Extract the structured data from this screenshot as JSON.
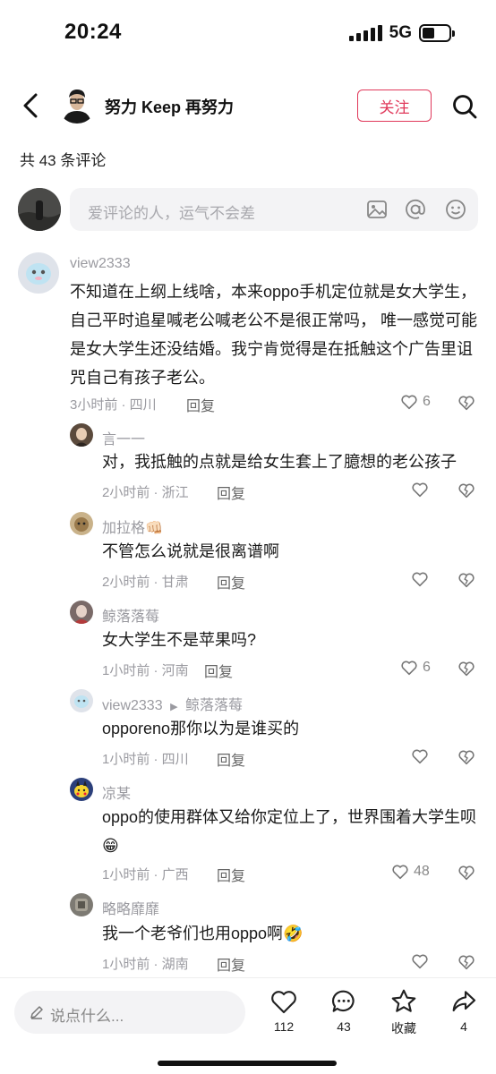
{
  "status": {
    "time": "20:24",
    "network": "5G"
  },
  "header": {
    "title": "努力 Keep 再努力",
    "follow_label": "关注"
  },
  "comment_count": "共 43 条评论",
  "input": {
    "placeholder": "爱评论的人，运气不会差"
  },
  "comments": [
    {
      "name": "view2333",
      "text": "不知道在上纲上线啥，本来oppo手机定位就是女大学生，自己平时追星喊老公喊老公不是很正常吗，  唯一感觉可能是女大学生还没结婚。我宁肯觉得是在抵触这个广告里诅咒自己有孩子老公。",
      "meta": "3小时前 · 四川",
      "reply": "回复",
      "likes": "6"
    },
    {
      "name": "言一一",
      "text": "对，我抵触的点就是给女生套上了臆想的老公孩子",
      "meta": "2小时前 · 浙江",
      "reply": "回复",
      "likes": ""
    },
    {
      "name": "加拉格👊🏻",
      "text": "不管怎么说就是很离谱啊",
      "meta": "2小时前 · 甘肃",
      "reply": "回复",
      "likes": ""
    },
    {
      "name": "鲸落落莓",
      "text": "女大学生不是苹果吗?",
      "meta": "1小时前 · 河南",
      "reply": "回复",
      "likes": "6"
    },
    {
      "name": "view2333",
      "reply_to": "鲸落落莓",
      "text": "opporeno那你以为是谁买的",
      "meta": "1小时前 · 四川",
      "reply": "回复",
      "likes": ""
    },
    {
      "name": "凉某",
      "text": "oppo的使用群体又给你定位上了，世界围着大学生呗😁",
      "meta": "1小时前 · 广西",
      "reply": "回复",
      "likes": "48"
    },
    {
      "name": "略略靡靡",
      "text": "我一个老爷们也用oppo啊🤣",
      "meta": "1小时前 · 湖南",
      "reply": "回复",
      "likes": ""
    }
  ],
  "bottom": {
    "say_placeholder": "说点什么...",
    "like_count": "112",
    "comment_count": "43",
    "favorite_label": "收藏",
    "share_count": "4"
  }
}
